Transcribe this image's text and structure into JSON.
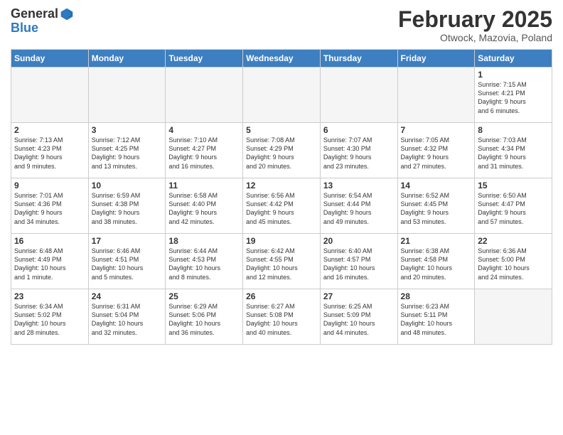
{
  "header": {
    "logo_general": "General",
    "logo_blue": "Blue",
    "month_title": "February 2025",
    "subtitle": "Otwock, Mazovia, Poland"
  },
  "weekdays": [
    "Sunday",
    "Monday",
    "Tuesday",
    "Wednesday",
    "Thursday",
    "Friday",
    "Saturday"
  ],
  "weeks": [
    [
      {
        "day": "",
        "info": ""
      },
      {
        "day": "",
        "info": ""
      },
      {
        "day": "",
        "info": ""
      },
      {
        "day": "",
        "info": ""
      },
      {
        "day": "",
        "info": ""
      },
      {
        "day": "",
        "info": ""
      },
      {
        "day": "1",
        "info": "Sunrise: 7:15 AM\nSunset: 4:21 PM\nDaylight: 9 hours\nand 6 minutes."
      }
    ],
    [
      {
        "day": "2",
        "info": "Sunrise: 7:13 AM\nSunset: 4:23 PM\nDaylight: 9 hours\nand 9 minutes."
      },
      {
        "day": "3",
        "info": "Sunrise: 7:12 AM\nSunset: 4:25 PM\nDaylight: 9 hours\nand 13 minutes."
      },
      {
        "day": "4",
        "info": "Sunrise: 7:10 AM\nSunset: 4:27 PM\nDaylight: 9 hours\nand 16 minutes."
      },
      {
        "day": "5",
        "info": "Sunrise: 7:08 AM\nSunset: 4:29 PM\nDaylight: 9 hours\nand 20 minutes."
      },
      {
        "day": "6",
        "info": "Sunrise: 7:07 AM\nSunset: 4:30 PM\nDaylight: 9 hours\nand 23 minutes."
      },
      {
        "day": "7",
        "info": "Sunrise: 7:05 AM\nSunset: 4:32 PM\nDaylight: 9 hours\nand 27 minutes."
      },
      {
        "day": "8",
        "info": "Sunrise: 7:03 AM\nSunset: 4:34 PM\nDaylight: 9 hours\nand 31 minutes."
      }
    ],
    [
      {
        "day": "9",
        "info": "Sunrise: 7:01 AM\nSunset: 4:36 PM\nDaylight: 9 hours\nand 34 minutes."
      },
      {
        "day": "10",
        "info": "Sunrise: 6:59 AM\nSunset: 4:38 PM\nDaylight: 9 hours\nand 38 minutes."
      },
      {
        "day": "11",
        "info": "Sunrise: 6:58 AM\nSunset: 4:40 PM\nDaylight: 9 hours\nand 42 minutes."
      },
      {
        "day": "12",
        "info": "Sunrise: 6:56 AM\nSunset: 4:42 PM\nDaylight: 9 hours\nand 45 minutes."
      },
      {
        "day": "13",
        "info": "Sunrise: 6:54 AM\nSunset: 4:44 PM\nDaylight: 9 hours\nand 49 minutes."
      },
      {
        "day": "14",
        "info": "Sunrise: 6:52 AM\nSunset: 4:45 PM\nDaylight: 9 hours\nand 53 minutes."
      },
      {
        "day": "15",
        "info": "Sunrise: 6:50 AM\nSunset: 4:47 PM\nDaylight: 9 hours\nand 57 minutes."
      }
    ],
    [
      {
        "day": "16",
        "info": "Sunrise: 6:48 AM\nSunset: 4:49 PM\nDaylight: 10 hours\nand 1 minute."
      },
      {
        "day": "17",
        "info": "Sunrise: 6:46 AM\nSunset: 4:51 PM\nDaylight: 10 hours\nand 5 minutes."
      },
      {
        "day": "18",
        "info": "Sunrise: 6:44 AM\nSunset: 4:53 PM\nDaylight: 10 hours\nand 8 minutes."
      },
      {
        "day": "19",
        "info": "Sunrise: 6:42 AM\nSunset: 4:55 PM\nDaylight: 10 hours\nand 12 minutes."
      },
      {
        "day": "20",
        "info": "Sunrise: 6:40 AM\nSunset: 4:57 PM\nDaylight: 10 hours\nand 16 minutes."
      },
      {
        "day": "21",
        "info": "Sunrise: 6:38 AM\nSunset: 4:58 PM\nDaylight: 10 hours\nand 20 minutes."
      },
      {
        "day": "22",
        "info": "Sunrise: 6:36 AM\nSunset: 5:00 PM\nDaylight: 10 hours\nand 24 minutes."
      }
    ],
    [
      {
        "day": "23",
        "info": "Sunrise: 6:34 AM\nSunset: 5:02 PM\nDaylight: 10 hours\nand 28 minutes."
      },
      {
        "day": "24",
        "info": "Sunrise: 6:31 AM\nSunset: 5:04 PM\nDaylight: 10 hours\nand 32 minutes."
      },
      {
        "day": "25",
        "info": "Sunrise: 6:29 AM\nSunset: 5:06 PM\nDaylight: 10 hours\nand 36 minutes."
      },
      {
        "day": "26",
        "info": "Sunrise: 6:27 AM\nSunset: 5:08 PM\nDaylight: 10 hours\nand 40 minutes."
      },
      {
        "day": "27",
        "info": "Sunrise: 6:25 AM\nSunset: 5:09 PM\nDaylight: 10 hours\nand 44 minutes."
      },
      {
        "day": "28",
        "info": "Sunrise: 6:23 AM\nSunset: 5:11 PM\nDaylight: 10 hours\nand 48 minutes."
      },
      {
        "day": "",
        "info": ""
      }
    ]
  ]
}
